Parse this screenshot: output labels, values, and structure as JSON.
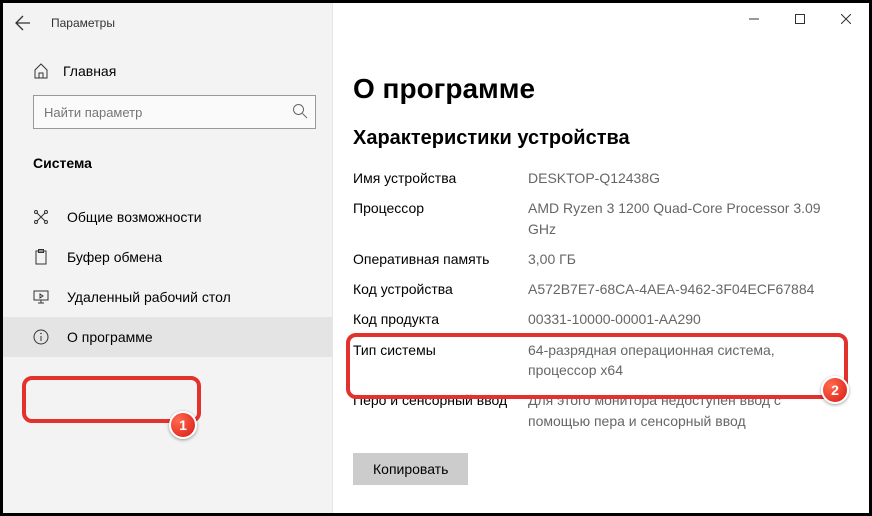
{
  "titlebar": {
    "title": "Параметры"
  },
  "sidebar": {
    "home": "Главная",
    "search_placeholder": "Найти параметр",
    "section": "Система",
    "items": [
      {
        "label": "Общие возможности"
      },
      {
        "label": "Буфер обмена"
      },
      {
        "label": "Удаленный рабочий стол"
      },
      {
        "label": "О программе"
      }
    ]
  },
  "main": {
    "heading": "О программе",
    "subheading": "Характеристики устройства",
    "rows": [
      {
        "label": "Имя устройства",
        "value": "DESKTOP-Q12438G"
      },
      {
        "label": "Процессор",
        "value": "AMD Ryzen 3 1200 Quad-Core Processor 3.09 GHz"
      },
      {
        "label": "Оперативная память",
        "value": "3,00 ГБ"
      },
      {
        "label": "Код устройства",
        "value": "A572B7E7-68CA-4AEA-9462-3F04ECF67884"
      },
      {
        "label": "Код продукта",
        "value": "00331-10000-00001-AA290"
      },
      {
        "label": "Тип системы",
        "value": "64-разрядная операционная система, процессор x64"
      },
      {
        "label": "Перо и сенсорный ввод",
        "value": "Для этого монитора недоступен ввод с помощью пера и сенсорный ввод"
      }
    ],
    "copy": "Копировать"
  },
  "callouts": {
    "one": "1",
    "two": "2"
  }
}
